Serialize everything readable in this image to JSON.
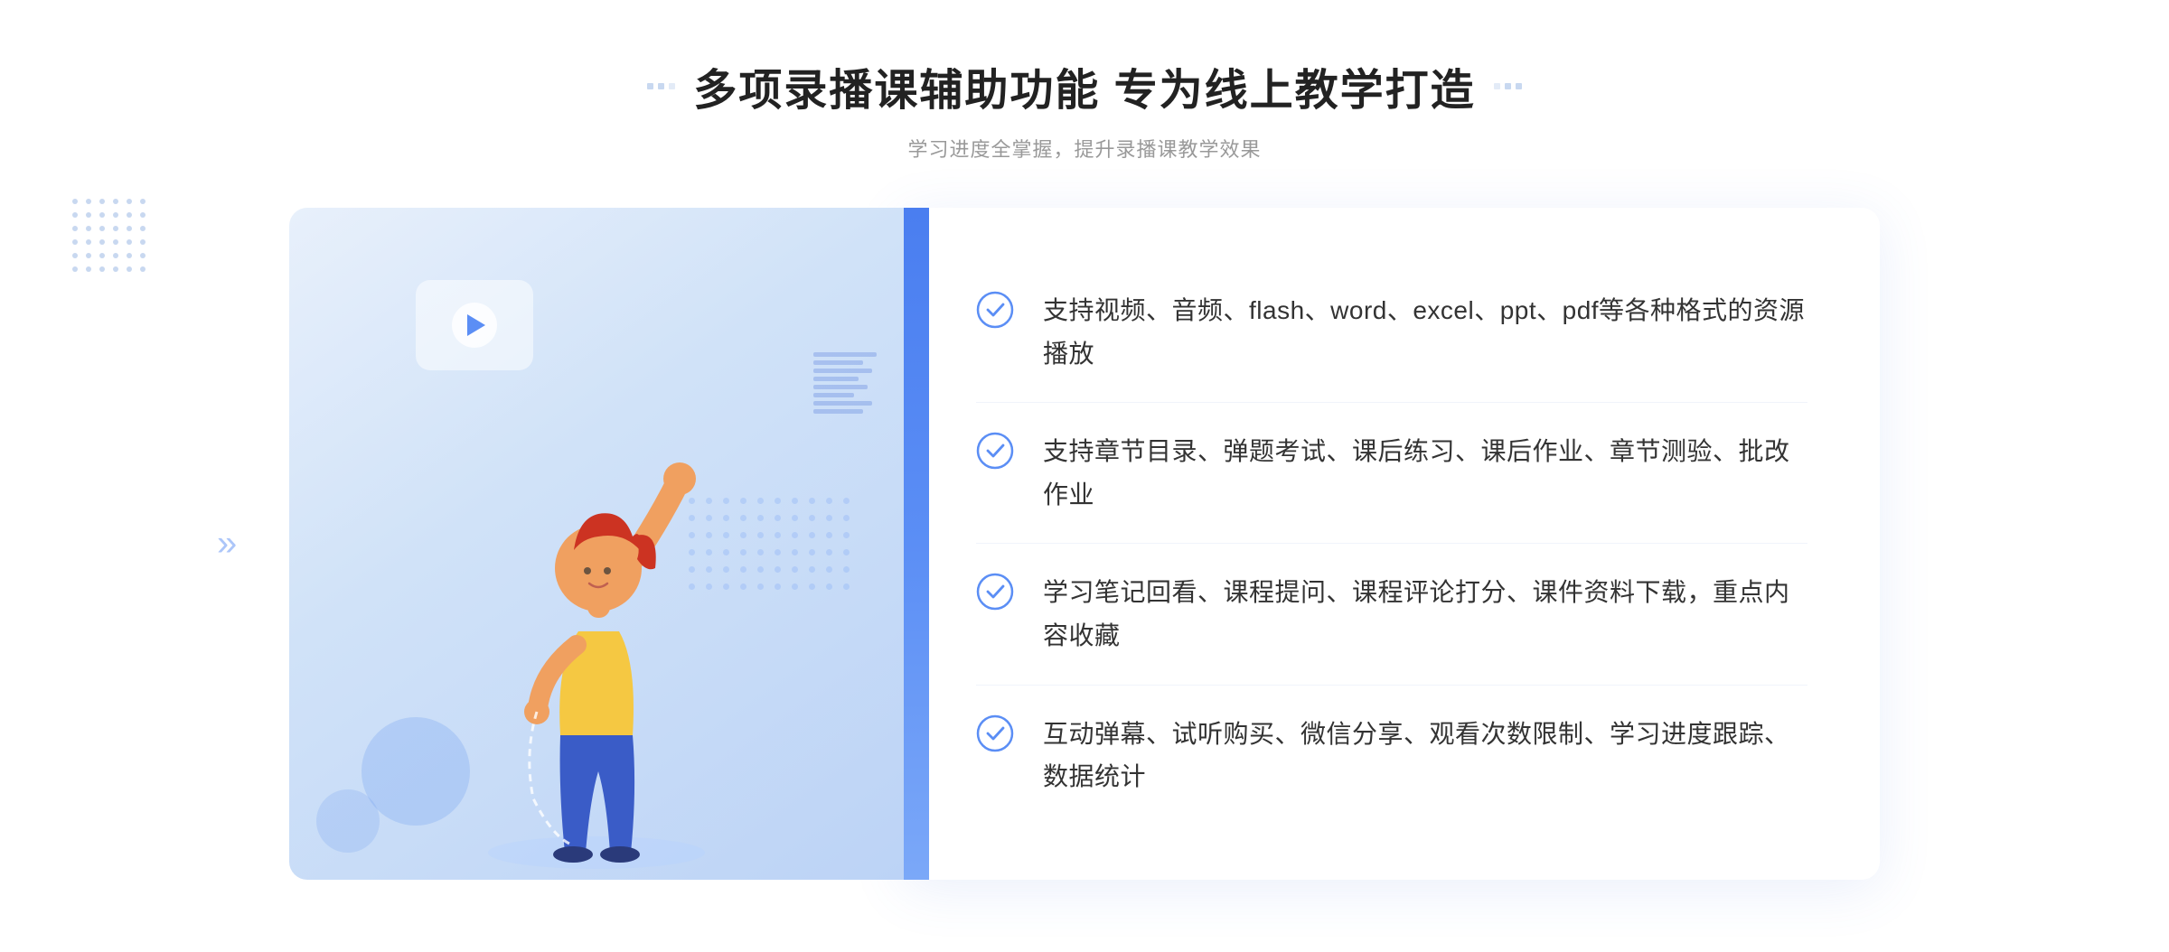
{
  "header": {
    "title": "多项录播课辅助功能 专为线上教学打造",
    "subtitle": "学习进度全掌握，提升录播课教学效果"
  },
  "features": [
    {
      "id": "feature-1",
      "text": "支持视频、音频、flash、word、excel、ppt、pdf等各种格式的资源播放"
    },
    {
      "id": "feature-2",
      "text": "支持章节目录、弹题考试、课后练习、课后作业、章节测验、批改作业"
    },
    {
      "id": "feature-3",
      "text": "学习笔记回看、课程提问、课程评论打分、课件资料下载，重点内容收藏"
    },
    {
      "id": "feature-4",
      "text": "互动弹幕、试听购买、微信分享、观看次数限制、学习进度跟踪、数据统计"
    }
  ],
  "decorators": {
    "left_arrow": "»",
    "right_title_dots": "⁚"
  }
}
